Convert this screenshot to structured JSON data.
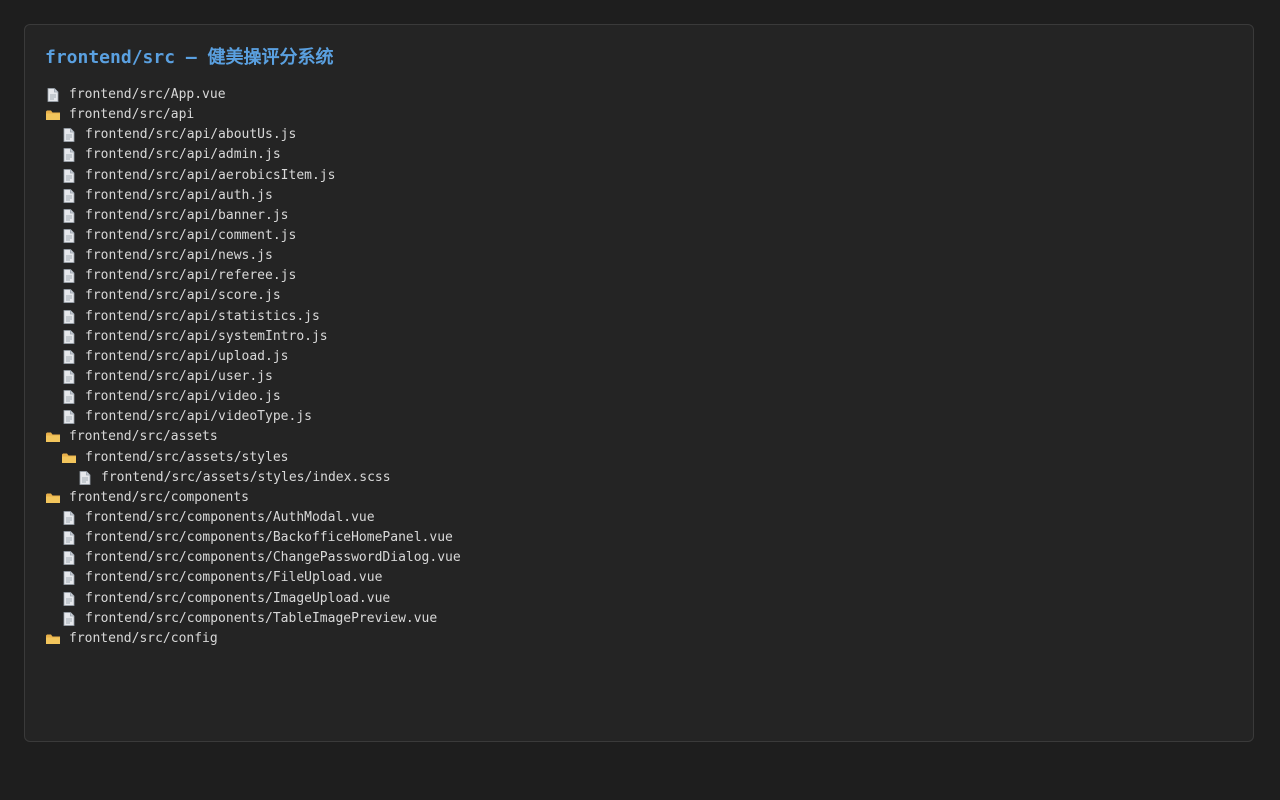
{
  "title": "frontend/src — 健美操评分系统",
  "colors": {
    "background": "#1e1e1e",
    "panel": "#242424",
    "title": "#5aa0e0",
    "text": "#d8d8d8",
    "folder": "#e8b04a",
    "file": "#e6e8ec"
  },
  "tree": [
    {
      "type": "file",
      "icon": "file-icon",
      "depth": 0,
      "label": "frontend/src/App.vue"
    },
    {
      "type": "folder",
      "icon": "folder-icon",
      "depth": 0,
      "label": "frontend/src/api"
    },
    {
      "type": "file",
      "icon": "file-icon",
      "depth": 1,
      "label": "frontend/src/api/aboutUs.js"
    },
    {
      "type": "file",
      "icon": "file-icon",
      "depth": 1,
      "label": "frontend/src/api/admin.js"
    },
    {
      "type": "file",
      "icon": "file-icon",
      "depth": 1,
      "label": "frontend/src/api/aerobicsItem.js"
    },
    {
      "type": "file",
      "icon": "file-icon",
      "depth": 1,
      "label": "frontend/src/api/auth.js"
    },
    {
      "type": "file",
      "icon": "file-icon",
      "depth": 1,
      "label": "frontend/src/api/banner.js"
    },
    {
      "type": "file",
      "icon": "file-icon",
      "depth": 1,
      "label": "frontend/src/api/comment.js"
    },
    {
      "type": "file",
      "icon": "file-icon",
      "depth": 1,
      "label": "frontend/src/api/news.js"
    },
    {
      "type": "file",
      "icon": "file-icon",
      "depth": 1,
      "label": "frontend/src/api/referee.js"
    },
    {
      "type": "file",
      "icon": "file-icon",
      "depth": 1,
      "label": "frontend/src/api/score.js"
    },
    {
      "type": "file",
      "icon": "file-icon",
      "depth": 1,
      "label": "frontend/src/api/statistics.js"
    },
    {
      "type": "file",
      "icon": "file-icon",
      "depth": 1,
      "label": "frontend/src/api/systemIntro.js"
    },
    {
      "type": "file",
      "icon": "file-icon",
      "depth": 1,
      "label": "frontend/src/api/upload.js"
    },
    {
      "type": "file",
      "icon": "file-icon",
      "depth": 1,
      "label": "frontend/src/api/user.js"
    },
    {
      "type": "file",
      "icon": "file-icon",
      "depth": 1,
      "label": "frontend/src/api/video.js"
    },
    {
      "type": "file",
      "icon": "file-icon",
      "depth": 1,
      "label": "frontend/src/api/videoType.js"
    },
    {
      "type": "folder",
      "icon": "folder-icon",
      "depth": 0,
      "label": "frontend/src/assets"
    },
    {
      "type": "folder",
      "icon": "folder-icon",
      "depth": 1,
      "label": "frontend/src/assets/styles"
    },
    {
      "type": "file",
      "icon": "file-icon",
      "depth": 2,
      "label": "frontend/src/assets/styles/index.scss"
    },
    {
      "type": "folder",
      "icon": "folder-icon",
      "depth": 0,
      "label": "frontend/src/components"
    },
    {
      "type": "file",
      "icon": "file-icon",
      "depth": 1,
      "label": "frontend/src/components/AuthModal.vue"
    },
    {
      "type": "file",
      "icon": "file-icon",
      "depth": 1,
      "label": "frontend/src/components/BackofficeHomePanel.vue"
    },
    {
      "type": "file",
      "icon": "file-icon",
      "depth": 1,
      "label": "frontend/src/components/ChangePasswordDialog.vue"
    },
    {
      "type": "file",
      "icon": "file-icon",
      "depth": 1,
      "label": "frontend/src/components/FileUpload.vue"
    },
    {
      "type": "file",
      "icon": "file-icon",
      "depth": 1,
      "label": "frontend/src/components/ImageUpload.vue"
    },
    {
      "type": "file",
      "icon": "file-icon",
      "depth": 1,
      "label": "frontend/src/components/TableImagePreview.vue"
    },
    {
      "type": "folder",
      "icon": "folder-icon",
      "depth": 0,
      "label": "frontend/src/config"
    }
  ]
}
